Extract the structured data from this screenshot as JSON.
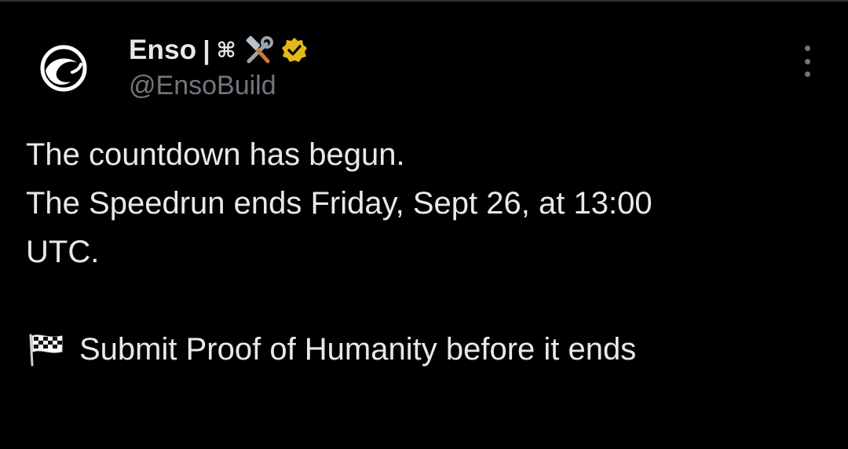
{
  "author": {
    "display_name": "Enso",
    "name_separator": "|",
    "name_symbol": "⌘",
    "name_icons": [
      "hammer-and-wrench-icon",
      "verified-badge-icon"
    ],
    "handle": "@EnsoBuild",
    "avatar": "enso-logo-icon"
  },
  "tweet": {
    "lines": [
      "The countdown has begun.",
      "The Speedrun ends Friday, Sept 26, at 13:00",
      "UTC."
    ],
    "cta_icon": "checkered-flag-icon",
    "cta_text": "Submit Proof of Humanity before it ends"
  },
  "menu": {
    "icon": "more-options-icon"
  },
  "colors": {
    "background": "#000000",
    "text_primary": "#e7e9ea",
    "text_secondary": "#71767b",
    "verified_badge": "#e2b719",
    "divider": "#2f3336"
  }
}
